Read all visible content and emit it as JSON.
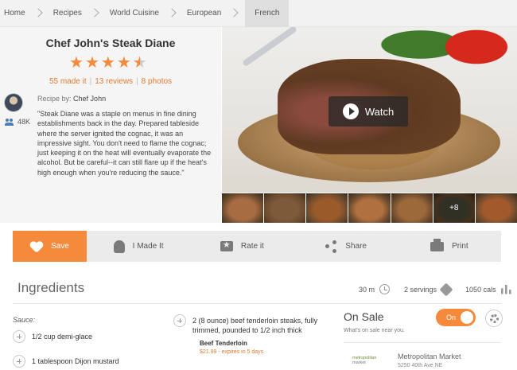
{
  "breadcrumb": [
    "Home",
    "Recipes",
    "World Cuisine",
    "European",
    "French"
  ],
  "recipe": {
    "title": "Chef John's Steak Diane",
    "rating": 4.5,
    "made_it": "55 made it",
    "reviews": "13 reviews",
    "photos": "8 photos",
    "recipe_by_label": "Recipe by:",
    "author": "Chef John",
    "followers": "48K",
    "description": "\"Steak Diane was a staple on menus in fine dining establishments back in the day. Prepared tableside where the server ignited the cognac, it was an impressive sight. You don't need to flame the cognac; just keeping it on the heat will eventually evaporate the alcohol. But be careful--it can still flare up if the heat's high enough when you're reducing the sauce.\""
  },
  "media": {
    "watch_label": "Watch",
    "more_photos": "+8",
    "thumb_colors": [
      "#a86c43",
      "#7c5a3a",
      "#9a5a2a",
      "#b07040",
      "#9c6a3a",
      "#4a4a3a",
      "#a25a2c"
    ]
  },
  "actions": [
    "Save",
    "I Made It",
    "Rate it",
    "Share",
    "Print"
  ],
  "ingredients": {
    "title": "Ingredients",
    "time": "30 m",
    "servings": "2 servings",
    "calories": "1050 cals",
    "section": "Sauce:",
    "items": [
      {
        "text": "1/2 cup demi-glace"
      },
      {
        "text": "1 tablespoon Dijon mustard"
      },
      {
        "text": "2 (8 ounce) beef tenderloin steaks, fully trimmed, pounded to 1/2 inch thick"
      }
    ],
    "promo_brand": "Beef Tenderloin",
    "promo_price": "$21.99 - expires in 5 days"
  },
  "sale": {
    "title": "On Sale",
    "subtitle": "What's on sale near you.",
    "toggle_label": "On",
    "store_logo_line1": "metropolitan",
    "store_logo_line2": "market",
    "store_name": "Metropolitan Market",
    "store_address": "5250 40th Ave NE"
  },
  "colors": {
    "accent": "#f58a3c",
    "breadcrumb_bg": "#f2f2f2",
    "actions_bg": "#ebebeb"
  }
}
